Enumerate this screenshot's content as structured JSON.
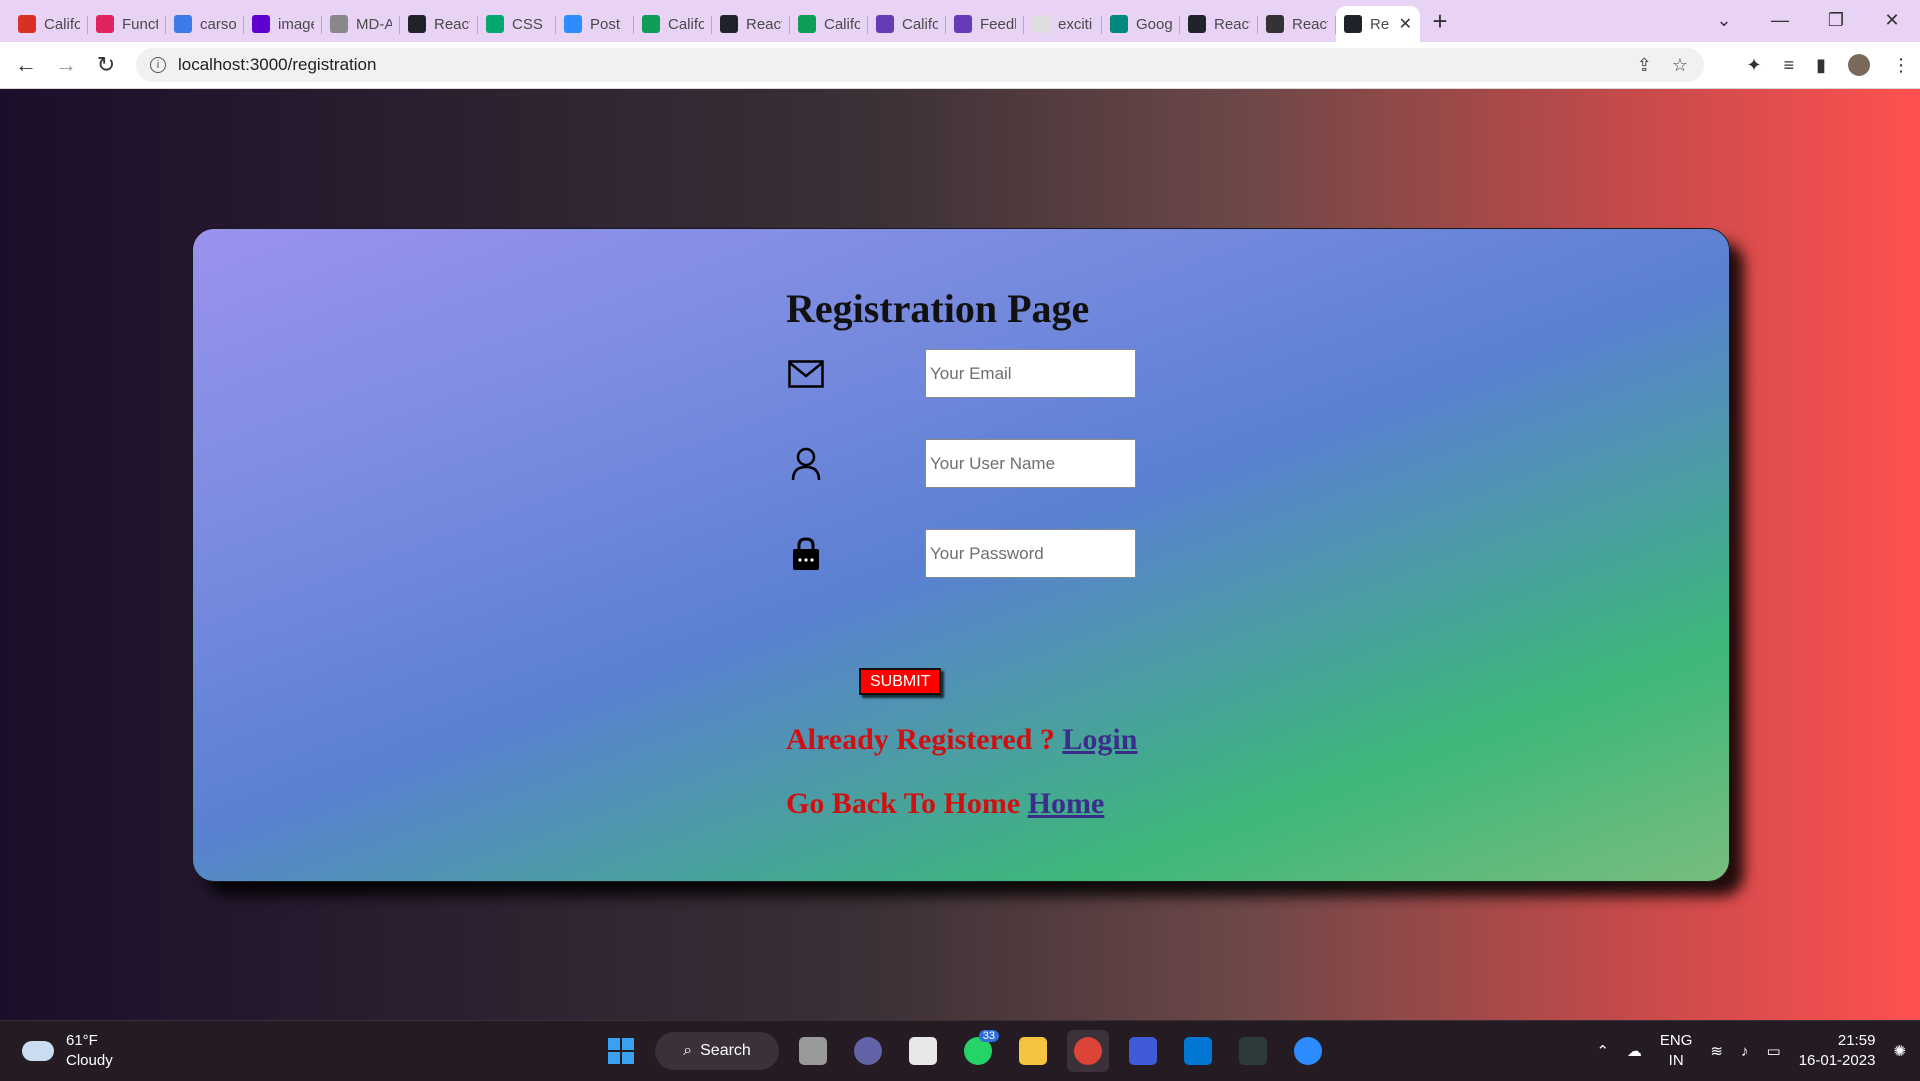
{
  "browser": {
    "tabs": [
      {
        "label": "Califo",
        "icon": "gmail-icon",
        "color": "#d93025"
      },
      {
        "label": "Funct",
        "icon": "shield-icon",
        "color": "#e0245e"
      },
      {
        "label": "carso",
        "icon": "bolt-icon",
        "color": "#3b7bea"
      },
      {
        "label": "image",
        "icon": "yahoo-icon",
        "color": "#6001d2"
      },
      {
        "label": "MD-A",
        "icon": "github-icon",
        "color": "#888888"
      },
      {
        "label": "React",
        "icon": "react-icon",
        "color": "#20232a"
      },
      {
        "label": "CSS B",
        "icon": "w3-icon",
        "color": "#04aa6d"
      },
      {
        "label": "Post",
        "icon": "z-icon",
        "color": "#2d8cff"
      },
      {
        "label": "Califo",
        "icon": "sheets-icon",
        "color": "#0f9d58"
      },
      {
        "label": "React",
        "icon": "react-icon",
        "color": "#20232a"
      },
      {
        "label": "Califo",
        "icon": "sheets-icon",
        "color": "#0f9d58"
      },
      {
        "label": "Califo",
        "icon": "forms-icon",
        "color": "#673ab7"
      },
      {
        "label": "Feedb",
        "icon": "forms-icon",
        "color": "#673ab7"
      },
      {
        "label": "exciti",
        "icon": "page-icon",
        "color": "#dddddd"
      },
      {
        "label": "Goog",
        "icon": "meet-icon",
        "color": "#00897b"
      },
      {
        "label": "React",
        "icon": "react-icon",
        "color": "#20232a"
      },
      {
        "label": "React",
        "icon": "globe-icon",
        "color": "#333333"
      },
      {
        "label": "Re",
        "icon": "react-icon",
        "color": "#20232a",
        "active": true
      }
    ],
    "new_tab": "+",
    "url": "localhost:3000/registration"
  },
  "page": {
    "title": "Registration Page",
    "email_placeholder": "Your Email",
    "username_placeholder": "Your User Name",
    "password_placeholder": "Your Password",
    "submit_label": "SUBMIT",
    "already_text": "Already Registered ? ",
    "login_link": "Login",
    "back_text": "Go Back To Home ",
    "home_link": "Home"
  },
  "taskbar": {
    "temperature": "61°F",
    "weather": "Cloudy",
    "search_label": "Search",
    "whatsapp_badge": "33",
    "lang_top": "ENG",
    "lang_bottom": "IN",
    "time": "21:59",
    "date": "16-01-2023"
  },
  "colors": {
    "heading_red": "#d01010",
    "link_purple": "#3b2e8a",
    "submit_red": "#ff0000"
  }
}
